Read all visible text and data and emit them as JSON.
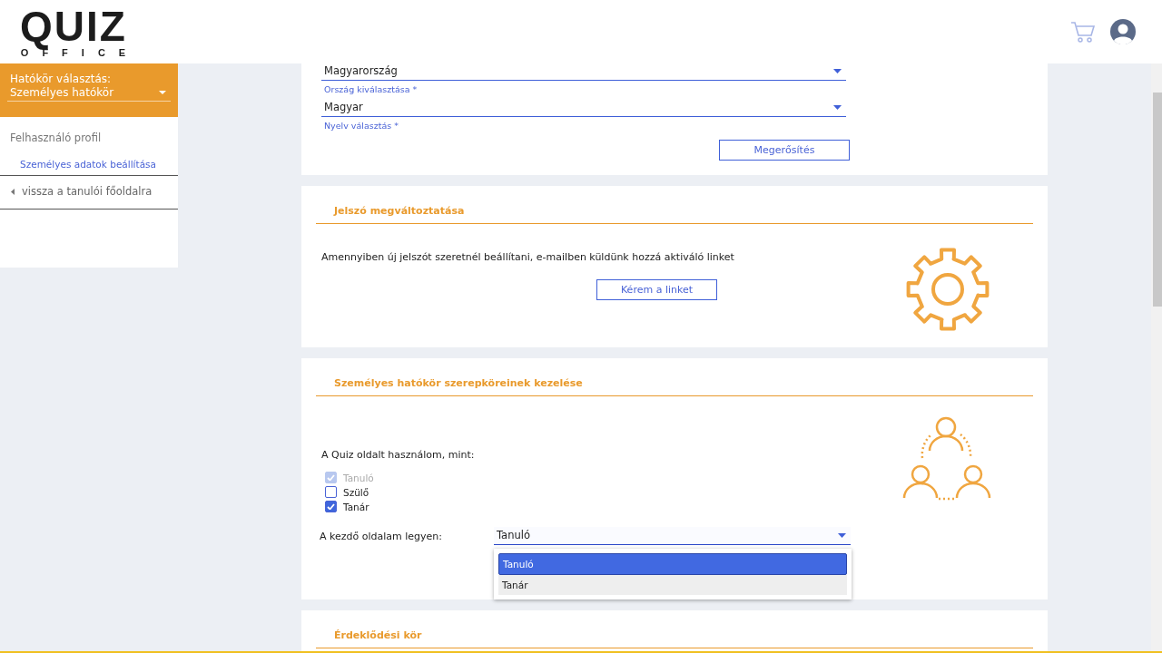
{
  "header": {
    "logo": {
      "title": "QUIZ",
      "subtitle": "OFFICE"
    }
  },
  "sidebar": {
    "scope_label": "Hatókör választás:",
    "scope_value": "Személyes hatókör",
    "items": [
      {
        "kind": "heading",
        "label": "Felhasználó profil",
        "selected": false
      },
      {
        "kind": "subitem",
        "label": "Személyes adatok beállítása",
        "selected": true
      },
      {
        "kind": "back",
        "label": "vissza a tanulói főoldalra",
        "selected": false
      }
    ]
  },
  "settings_card": {
    "fields": [
      {
        "value": "Magyarország",
        "label": "Ország kiválasztása *"
      },
      {
        "value": "Magyar",
        "label": "Nyelv választás *"
      }
    ],
    "button": "Megerősítés"
  },
  "password_card": {
    "title": "Jelszó megváltoztatása",
    "text": "Amennyiben új jelszót szeretnél beállítani, e-mailben küldünk hozzá aktiváló linket",
    "button": "Kérem a linket"
  },
  "roles_card": {
    "title": "Személyes hatókör szerepköreinek kezelése",
    "intro": "A Quiz oldalt használom, mint:",
    "roles": [
      {
        "label": "Tanuló",
        "checked": true,
        "disabled": true
      },
      {
        "label": "Szülő",
        "checked": false,
        "disabled": false
      },
      {
        "label": "Tanár",
        "checked": true,
        "disabled": false
      }
    ],
    "start_page": {
      "label": "A kezdő oldalam legyen:",
      "value": "Tanuló",
      "expanded": true,
      "options": [
        {
          "label": "Tanuló",
          "selected": true
        },
        {
          "label": "Tanár",
          "selected": false
        }
      ]
    }
  },
  "interests_card": {
    "title": "Érdeklődési kör"
  }
}
